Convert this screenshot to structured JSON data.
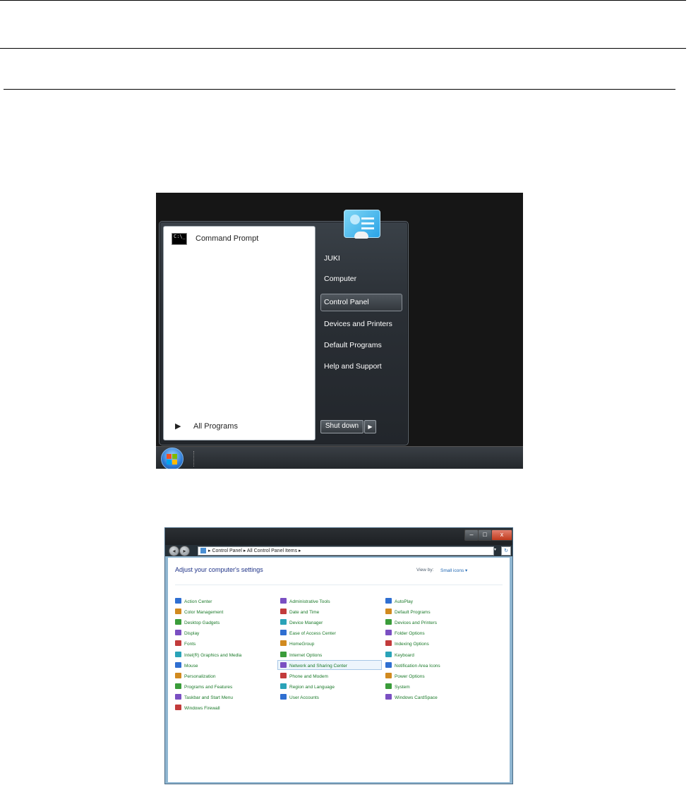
{
  "start_menu": {
    "pinned": [
      {
        "label": "Command Prompt",
        "icon": "cmd-icon",
        "icon_text": "C:\\_"
      }
    ],
    "all_programs": "All Programs",
    "right_items": [
      {
        "label": "JUKI"
      },
      {
        "label": "Computer"
      },
      {
        "label": "Control Panel",
        "highlighted": true
      },
      {
        "label": "Devices and Printers"
      },
      {
        "label": "Default Programs"
      },
      {
        "label": "Help and Support"
      }
    ],
    "shutdown_label": "Shut down",
    "shutdown_arrow": "▶",
    "all_programs_arrow": "▶"
  },
  "control_panel": {
    "window_buttons": {
      "minimize": "–",
      "maximize": "□",
      "close": "x"
    },
    "breadcrumb": [
      "Control Panel",
      "All Control Panel Items"
    ],
    "breadcrumb_text": "▸ Control Panel ▸ All Control Panel Items ▸",
    "title": "Adjust your computer's settings",
    "view_by_label": "View by:",
    "view_by_value": "Small icons ▾",
    "columns": [
      [
        "Action Center",
        "Color Management",
        "Desktop Gadgets",
        "Display",
        "Fonts",
        "Intel(R) Graphics and Media",
        "Mouse",
        "Personalization",
        "Programs and Features",
        "Taskbar and Start Menu",
        "Windows Firewall"
      ],
      [
        "Administrative Tools",
        "Date and Time",
        "Device Manager",
        "Ease of Access Center",
        "HomeGroup",
        "Internet Options",
        "Network and Sharing Center",
        "Phone and Modem",
        "Region and Language",
        "User Accounts"
      ],
      [
        "AutoPlay",
        "Default Programs",
        "Devices and Printers",
        "Folder Options",
        "Indexing Options",
        "Keyboard",
        "Notification Area Icons",
        "Power Options",
        "System",
        "Windows CardSpace"
      ]
    ],
    "highlighted_item": "Network and Sharing Center",
    "colors": {
      "item_text": "#1b7a2a",
      "title": "#1e3287",
      "highlight": "#edf5fc"
    }
  }
}
